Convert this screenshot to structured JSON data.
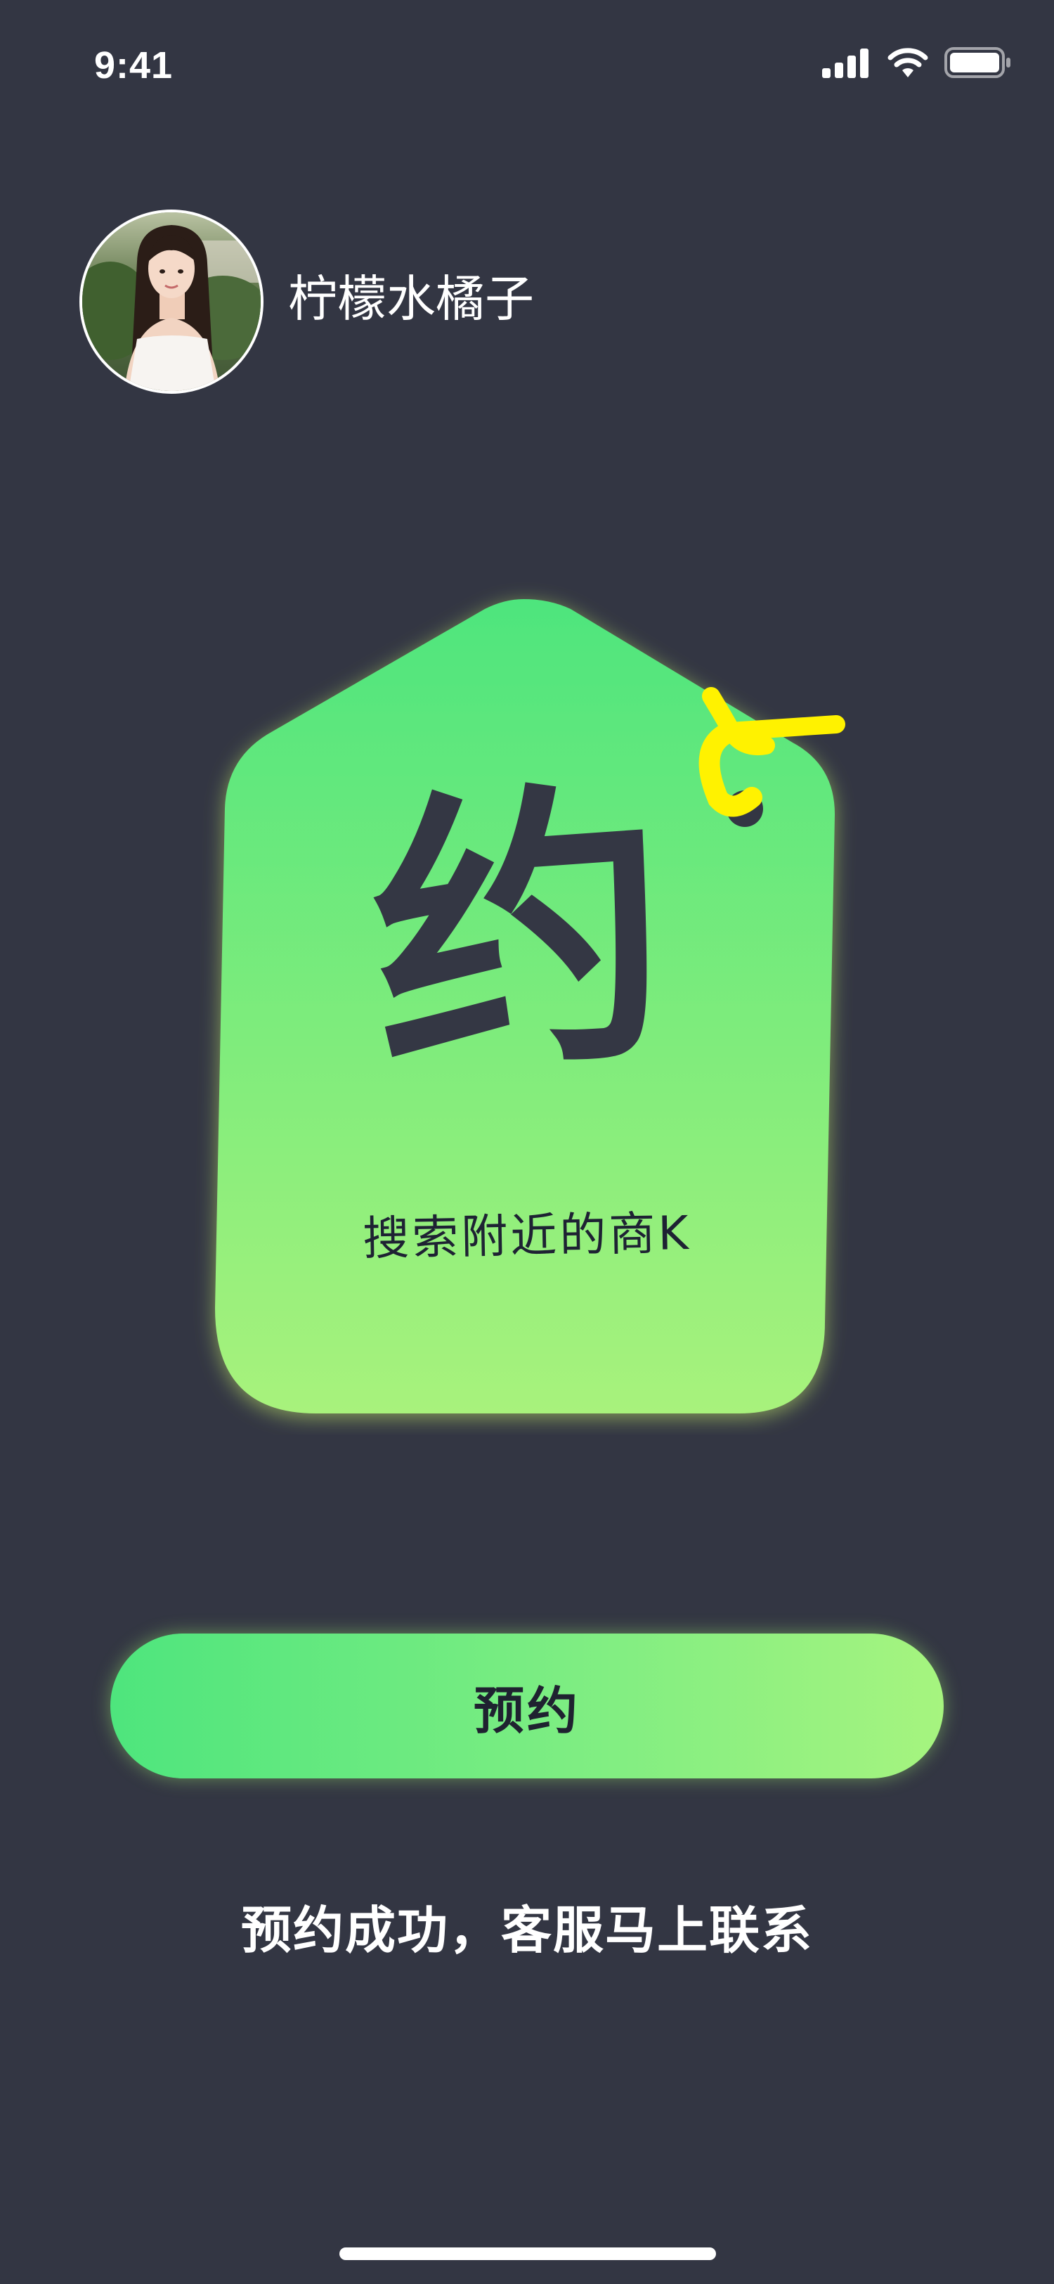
{
  "status_bar": {
    "time": "9:41",
    "signal_icon": "cellular-signal-icon",
    "wifi_icon": "wifi-icon",
    "battery_icon": "battery-full-icon"
  },
  "profile": {
    "name": "柠檬水橘子",
    "avatar": "avatar-photo"
  },
  "tag_card": {
    "glyph": "约",
    "subtitle": "搜索附近的商K",
    "colors": {
      "gradient_top": "#4ee57d",
      "gradient_bottom": "#a8f27c",
      "string": "#fff200"
    }
  },
  "actions": {
    "reserve_label": "预约"
  },
  "messages": {
    "success": "预约成功，客服马上联系"
  },
  "theme": {
    "background": "#333643",
    "accent_green": "#4ee57d",
    "accent_lime": "#a6f47f"
  }
}
